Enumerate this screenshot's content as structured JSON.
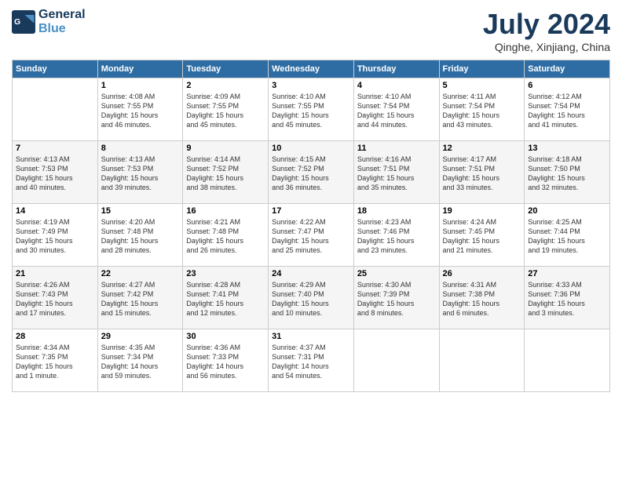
{
  "header": {
    "logo_line1": "General",
    "logo_line2": "Blue",
    "month": "July 2024",
    "location": "Qinghe, Xinjiang, China"
  },
  "weekdays": [
    "Sunday",
    "Monday",
    "Tuesday",
    "Wednesday",
    "Thursday",
    "Friday",
    "Saturday"
  ],
  "weeks": [
    [
      {
        "day": "",
        "info": ""
      },
      {
        "day": "1",
        "info": "Sunrise: 4:08 AM\nSunset: 7:55 PM\nDaylight: 15 hours\nand 46 minutes."
      },
      {
        "day": "2",
        "info": "Sunrise: 4:09 AM\nSunset: 7:55 PM\nDaylight: 15 hours\nand 45 minutes."
      },
      {
        "day": "3",
        "info": "Sunrise: 4:10 AM\nSunset: 7:55 PM\nDaylight: 15 hours\nand 45 minutes."
      },
      {
        "day": "4",
        "info": "Sunrise: 4:10 AM\nSunset: 7:54 PM\nDaylight: 15 hours\nand 44 minutes."
      },
      {
        "day": "5",
        "info": "Sunrise: 4:11 AM\nSunset: 7:54 PM\nDaylight: 15 hours\nand 43 minutes."
      },
      {
        "day": "6",
        "info": "Sunrise: 4:12 AM\nSunset: 7:54 PM\nDaylight: 15 hours\nand 41 minutes."
      }
    ],
    [
      {
        "day": "7",
        "info": "Sunrise: 4:13 AM\nSunset: 7:53 PM\nDaylight: 15 hours\nand 40 minutes."
      },
      {
        "day": "8",
        "info": "Sunrise: 4:13 AM\nSunset: 7:53 PM\nDaylight: 15 hours\nand 39 minutes."
      },
      {
        "day": "9",
        "info": "Sunrise: 4:14 AM\nSunset: 7:52 PM\nDaylight: 15 hours\nand 38 minutes."
      },
      {
        "day": "10",
        "info": "Sunrise: 4:15 AM\nSunset: 7:52 PM\nDaylight: 15 hours\nand 36 minutes."
      },
      {
        "day": "11",
        "info": "Sunrise: 4:16 AM\nSunset: 7:51 PM\nDaylight: 15 hours\nand 35 minutes."
      },
      {
        "day": "12",
        "info": "Sunrise: 4:17 AM\nSunset: 7:51 PM\nDaylight: 15 hours\nand 33 minutes."
      },
      {
        "day": "13",
        "info": "Sunrise: 4:18 AM\nSunset: 7:50 PM\nDaylight: 15 hours\nand 32 minutes."
      }
    ],
    [
      {
        "day": "14",
        "info": "Sunrise: 4:19 AM\nSunset: 7:49 PM\nDaylight: 15 hours\nand 30 minutes."
      },
      {
        "day": "15",
        "info": "Sunrise: 4:20 AM\nSunset: 7:48 PM\nDaylight: 15 hours\nand 28 minutes."
      },
      {
        "day": "16",
        "info": "Sunrise: 4:21 AM\nSunset: 7:48 PM\nDaylight: 15 hours\nand 26 minutes."
      },
      {
        "day": "17",
        "info": "Sunrise: 4:22 AM\nSunset: 7:47 PM\nDaylight: 15 hours\nand 25 minutes."
      },
      {
        "day": "18",
        "info": "Sunrise: 4:23 AM\nSunset: 7:46 PM\nDaylight: 15 hours\nand 23 minutes."
      },
      {
        "day": "19",
        "info": "Sunrise: 4:24 AM\nSunset: 7:45 PM\nDaylight: 15 hours\nand 21 minutes."
      },
      {
        "day": "20",
        "info": "Sunrise: 4:25 AM\nSunset: 7:44 PM\nDaylight: 15 hours\nand 19 minutes."
      }
    ],
    [
      {
        "day": "21",
        "info": "Sunrise: 4:26 AM\nSunset: 7:43 PM\nDaylight: 15 hours\nand 17 minutes."
      },
      {
        "day": "22",
        "info": "Sunrise: 4:27 AM\nSunset: 7:42 PM\nDaylight: 15 hours\nand 15 minutes."
      },
      {
        "day": "23",
        "info": "Sunrise: 4:28 AM\nSunset: 7:41 PM\nDaylight: 15 hours\nand 12 minutes."
      },
      {
        "day": "24",
        "info": "Sunrise: 4:29 AM\nSunset: 7:40 PM\nDaylight: 15 hours\nand 10 minutes."
      },
      {
        "day": "25",
        "info": "Sunrise: 4:30 AM\nSunset: 7:39 PM\nDaylight: 15 hours\nand 8 minutes."
      },
      {
        "day": "26",
        "info": "Sunrise: 4:31 AM\nSunset: 7:38 PM\nDaylight: 15 hours\nand 6 minutes."
      },
      {
        "day": "27",
        "info": "Sunrise: 4:33 AM\nSunset: 7:36 PM\nDaylight: 15 hours\nand 3 minutes."
      }
    ],
    [
      {
        "day": "28",
        "info": "Sunrise: 4:34 AM\nSunset: 7:35 PM\nDaylight: 15 hours\nand 1 minute."
      },
      {
        "day": "29",
        "info": "Sunrise: 4:35 AM\nSunset: 7:34 PM\nDaylight: 14 hours\nand 59 minutes."
      },
      {
        "day": "30",
        "info": "Sunrise: 4:36 AM\nSunset: 7:33 PM\nDaylight: 14 hours\nand 56 minutes."
      },
      {
        "day": "31",
        "info": "Sunrise: 4:37 AM\nSunset: 7:31 PM\nDaylight: 14 hours\nand 54 minutes."
      },
      {
        "day": "",
        "info": ""
      },
      {
        "day": "",
        "info": ""
      },
      {
        "day": "",
        "info": ""
      }
    ]
  ]
}
